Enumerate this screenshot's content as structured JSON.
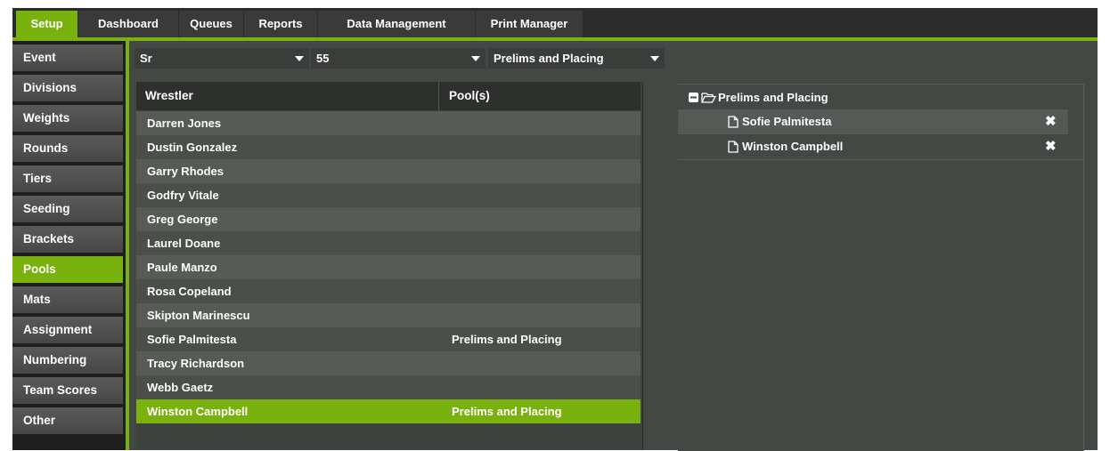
{
  "top_tabs": [
    "Setup",
    "Dashboard",
    "Queues",
    "Reports",
    "Data Management",
    "Print Manager"
  ],
  "active_top_tab": "Setup",
  "sidebar": {
    "items": [
      "Event",
      "Divisions",
      "Weights",
      "Rounds",
      "Tiers",
      "Seeding",
      "Brackets",
      "Pools",
      "Mats",
      "Assignment",
      "Numbering",
      "Team Scores",
      "Other"
    ],
    "active": "Pools"
  },
  "filters": {
    "division": "Sr",
    "weight": "55",
    "pool": "Prelims and Placing"
  },
  "grid": {
    "columns": [
      "Wrestler",
      "Pool(s)"
    ],
    "rows": [
      {
        "wrestler": "Darren Jones",
        "pools": ""
      },
      {
        "wrestler": "Dustin Gonzalez",
        "pools": ""
      },
      {
        "wrestler": "Garry Rhodes",
        "pools": ""
      },
      {
        "wrestler": "Godfry Vitale",
        "pools": ""
      },
      {
        "wrestler": "Greg George",
        "pools": ""
      },
      {
        "wrestler": "Laurel Doane",
        "pools": ""
      },
      {
        "wrestler": "Paule Manzo",
        "pools": ""
      },
      {
        "wrestler": "Rosa Copeland",
        "pools": ""
      },
      {
        "wrestler": "Skipton Marinescu",
        "pools": ""
      },
      {
        "wrestler": "Sofie Palmitesta",
        "pools": "Prelims and Placing"
      },
      {
        "wrestler": "Tracy Richardson",
        "pools": ""
      },
      {
        "wrestler": "Webb Gaetz",
        "pools": ""
      },
      {
        "wrestler": "Winston Campbell",
        "pools": "Prelims and Placing"
      }
    ],
    "selected_index": 12
  },
  "tree": {
    "root": "Prelims and Placing",
    "children": [
      "Sofie Palmitesta",
      "Winston Campbell"
    ],
    "remove_glyph": "✖"
  },
  "colors": {
    "accent": "#79b10f",
    "panel": "#444844",
    "topbar": "#2b2b2b"
  }
}
